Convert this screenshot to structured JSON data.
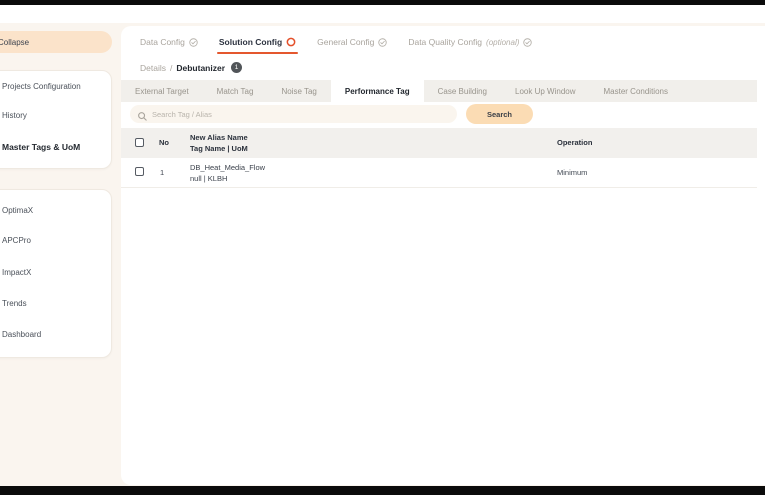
{
  "sidebar": {
    "collapse_label": "Collapse",
    "group1": [
      "Projects Configuration",
      "History",
      "Master Tags & UoM"
    ],
    "group2": [
      "OptimaX",
      "APCPro",
      "ImpactX",
      "Trends",
      "Dashboard"
    ]
  },
  "stepper": {
    "steps": [
      {
        "label": "Data Config",
        "status": "done"
      },
      {
        "label": "Solution Config",
        "status": "active"
      },
      {
        "label": "General Config",
        "status": "done"
      },
      {
        "label": "Data Quality Config",
        "suffix": "(optional)",
        "status": "done"
      }
    ]
  },
  "breadcrumb": {
    "parent": "Details",
    "separator": "/",
    "current": "Debutanizer",
    "badge_count": "1"
  },
  "tabs": [
    "External Target",
    "Match Tag",
    "Noise Tag",
    "Performance Tag",
    "Case Building",
    "Look Up Window",
    "Master Conditions"
  ],
  "active_tab": "Performance Tag",
  "search": {
    "placeholder": "Search Tag / Alias",
    "button_label": "Search"
  },
  "table": {
    "headers": {
      "no": "No",
      "alias_line1": "New Alias Name",
      "alias_line2": "Tag Name | UoM",
      "operation": "Operation"
    },
    "rows": [
      {
        "no": "1",
        "alias": "DB_Heat_Media_Flow",
        "tag_uom": "null | KLBH",
        "operation": "Minimum"
      }
    ]
  },
  "colors": {
    "accent_orange": "#e4572e",
    "pill_peach": "#fbe3ca",
    "button_peach": "#fbdcb4",
    "page_bg": "#faf5ef",
    "badge_dark": "#515559"
  }
}
